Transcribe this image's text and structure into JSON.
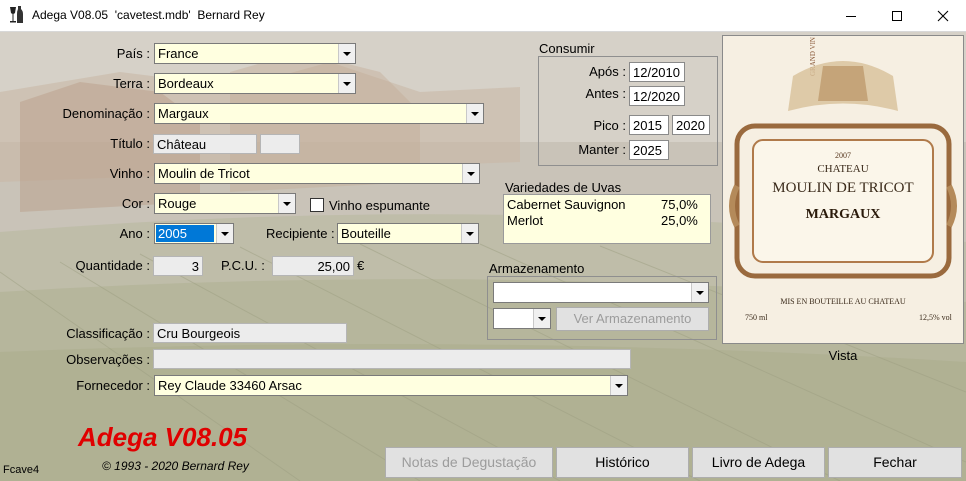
{
  "window": {
    "title": "Adega V08.05  'cavetest.mdb'  Bernard Rey",
    "minimize": "minimize",
    "maximize": "maximize",
    "close": "close"
  },
  "form": {
    "pais_label": "País :",
    "pais_value": "France",
    "terra_label": "Terra :",
    "terra_value": "Bordeaux",
    "denominacao_label": "Denominação :",
    "denominacao_value": "Margaux",
    "titulo_label": "Título :",
    "titulo_value": "Château",
    "titulo_extra": "",
    "vinho_label": "Vinho :",
    "vinho_value": "Moulin de Tricot",
    "cor_label": "Cor :",
    "cor_value": "Rouge",
    "espumante_label": "Vinho espumante",
    "ano_label": "Ano :",
    "ano_value": "2005",
    "recipiente_label": "Recipiente :",
    "recipiente_value": "Bouteille",
    "quantidade_label": "Quantidade :",
    "quantidade_value": "3",
    "pcu_label": "P.C.U. :",
    "pcu_value": "25,00",
    "currency": "€",
    "classificacao_label": "Classificação :",
    "classificacao_value": "Cru Bourgeois",
    "observacoes_label": "Observações :",
    "observacoes_value": "",
    "fornecedor_label": "Fornecedor :",
    "fornecedor_value": "Rey Claude 33460 Arsac"
  },
  "consumir": {
    "title": "Consumir",
    "apos_label": "Após :",
    "apos_value": "12/2010",
    "antes_label": "Antes :",
    "antes_value": "12/2020",
    "pico_label": "Pico :",
    "pico_from": "2015",
    "pico_to": "2020",
    "manter_label": "Manter :",
    "manter_value": "2025"
  },
  "uvas": {
    "title": "Variedades de Uvas",
    "items": [
      {
        "name": "Cabernet Sauvignon",
        "pct": "75,0%"
      },
      {
        "name": "Merlot",
        "pct": "25,0%"
      }
    ]
  },
  "armazenamento": {
    "title": "Armazenamento",
    "location_value": "",
    "slot_value": "",
    "ver_button": "Ver Armazenamento"
  },
  "label_image": {
    "caption": "Vista",
    "line1": "CHATEAU",
    "line2": "MOULIN DE TRICOT",
    "line3": "MARGAUX",
    "line4": "MIS EN BOUTEILLE AU CHATEAU",
    "vintage": "2007",
    "volume": "750 ml",
    "alcohol": "12,5% vol"
  },
  "branding": {
    "name": "Adega V08.05",
    "copyright": "© 1993 - 2020 Bernard Rey",
    "form_id": "Fcave4"
  },
  "buttons": {
    "notas": "Notas de Degustação",
    "historico": "Histórico",
    "livro": "Livro de Adega",
    "fechar": "Fechar"
  },
  "colors": {
    "field_bg": "#ffffe0",
    "brand_red": "#e00000",
    "selection": "#0078d7"
  }
}
